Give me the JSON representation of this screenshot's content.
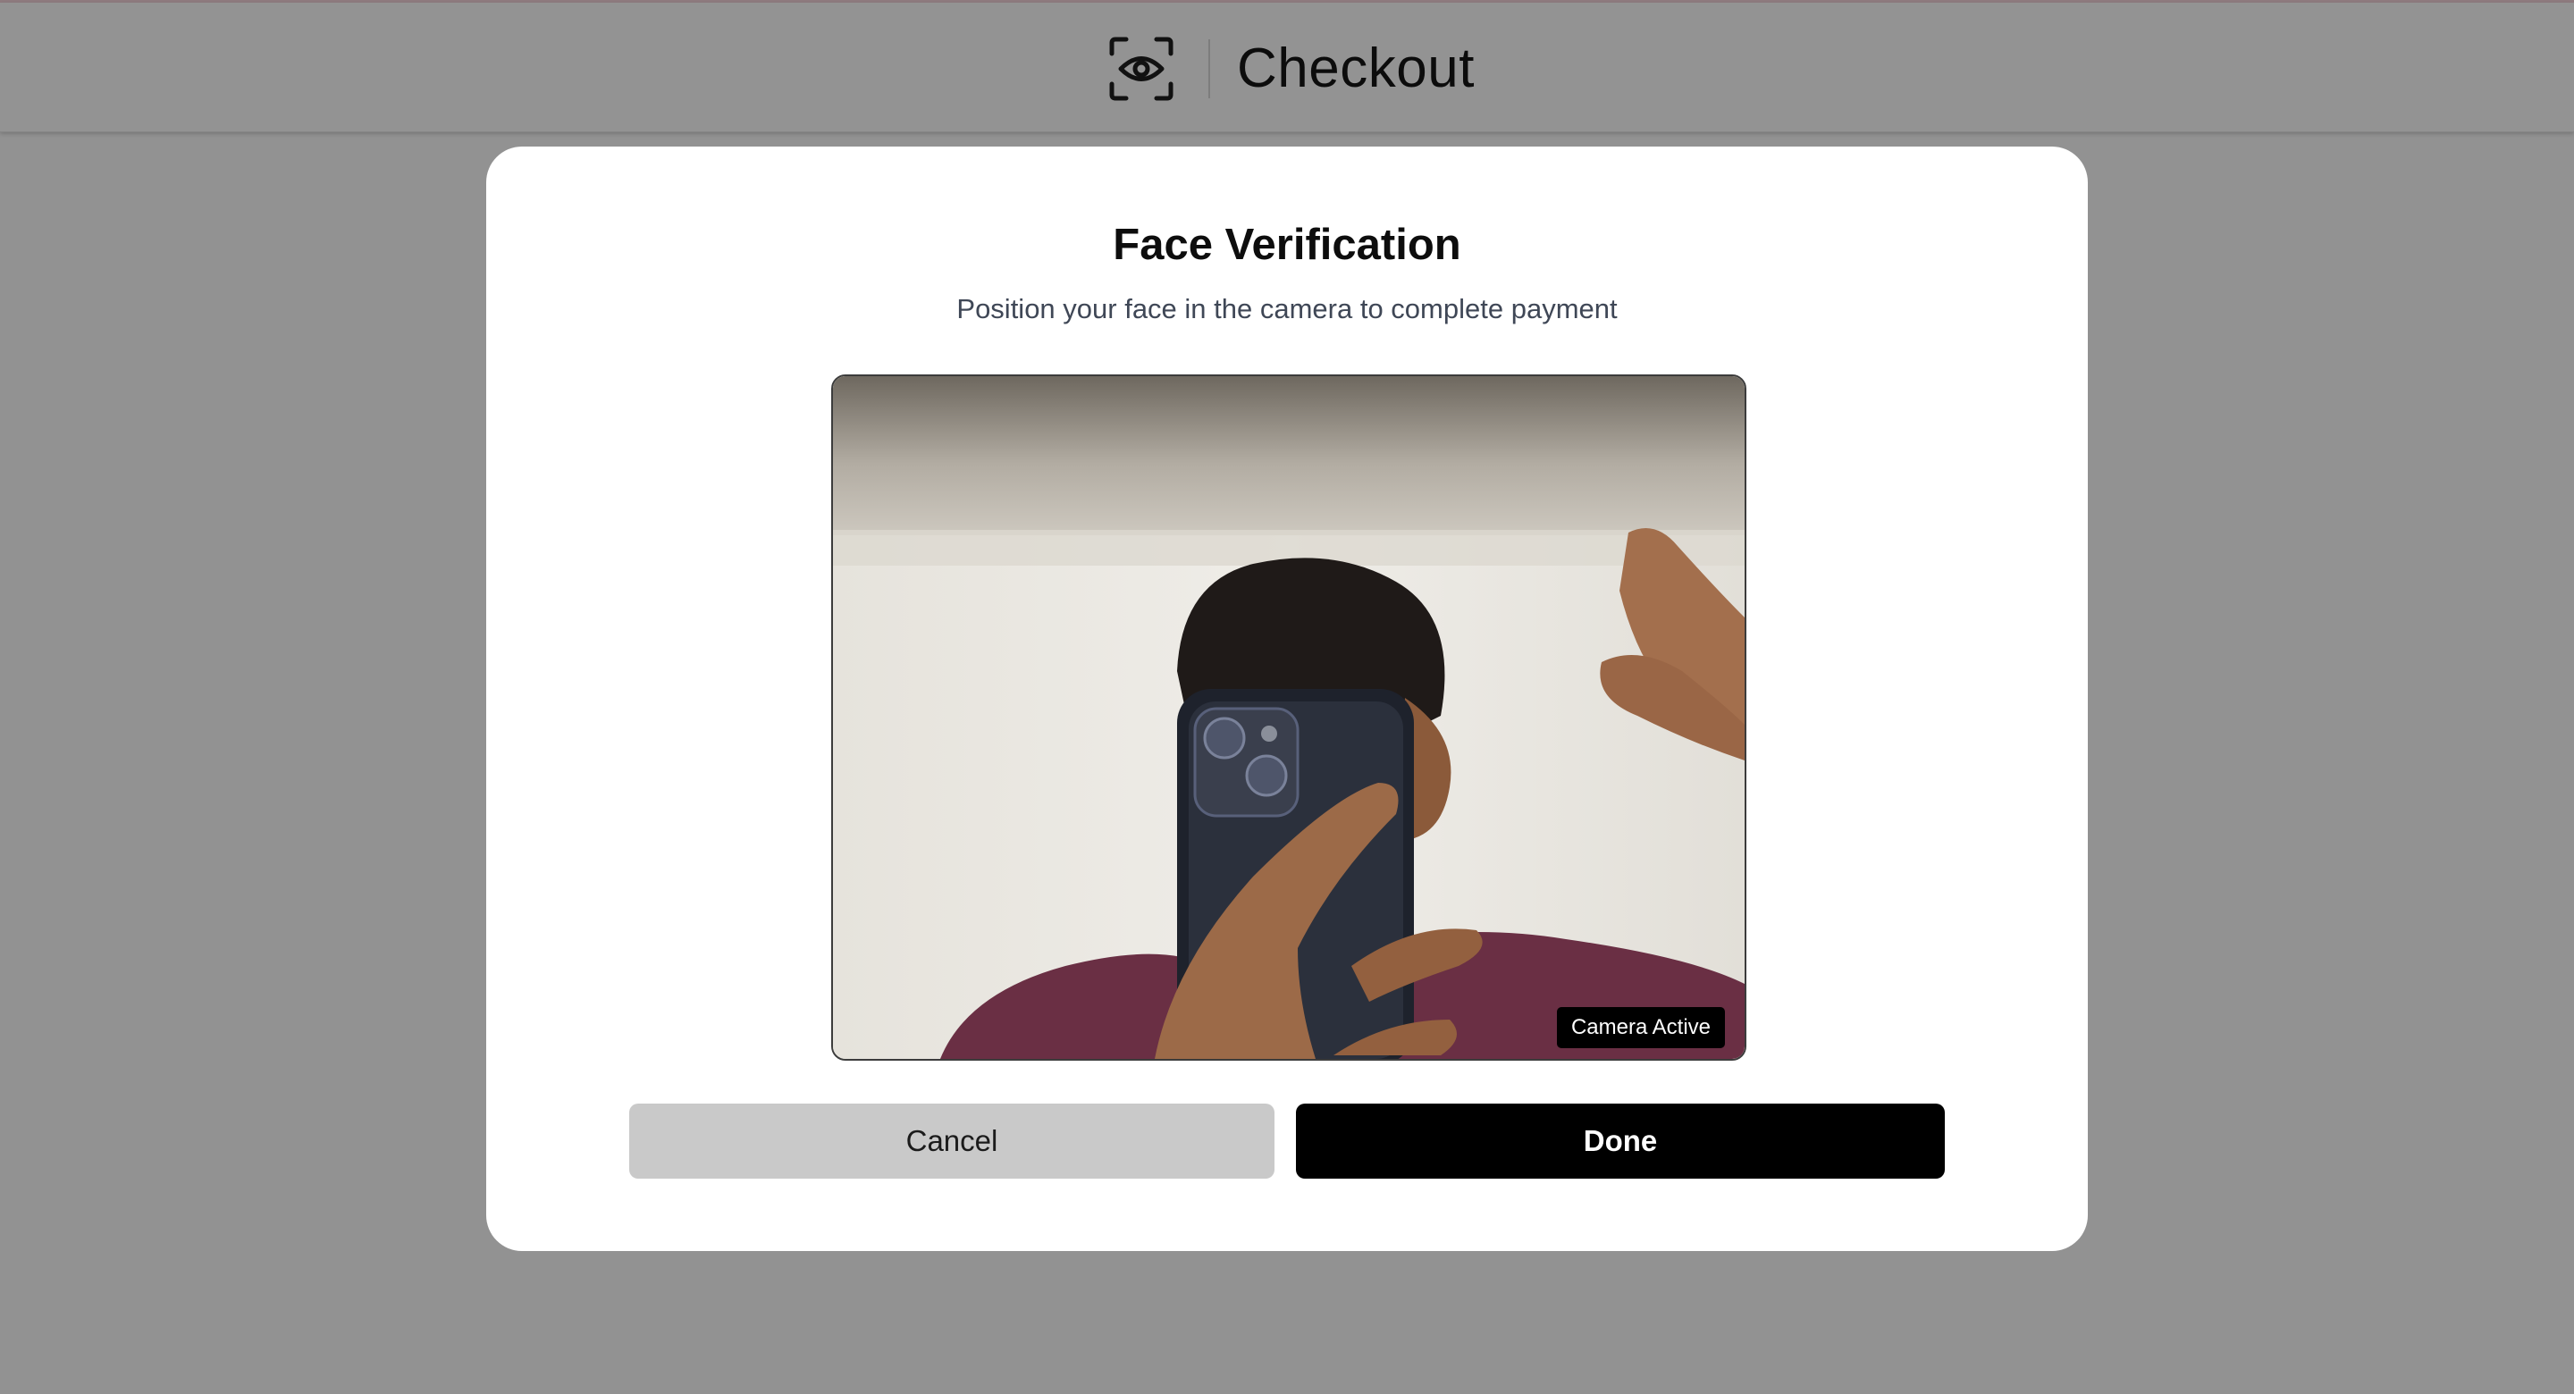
{
  "header": {
    "brand_icon": "eye-scan-icon",
    "title": "Checkout"
  },
  "modal": {
    "title": "Face Verification",
    "subtitle": "Position your face in the camera to complete payment",
    "camera": {
      "status_label": "Camera Active"
    },
    "buttons": {
      "cancel_label": "Cancel",
      "done_label": "Done"
    }
  },
  "colors": {
    "backdrop": "#929292",
    "modal_background": "#ffffff",
    "cancel_button": "#c9c9c9",
    "done_button": "#000000"
  }
}
